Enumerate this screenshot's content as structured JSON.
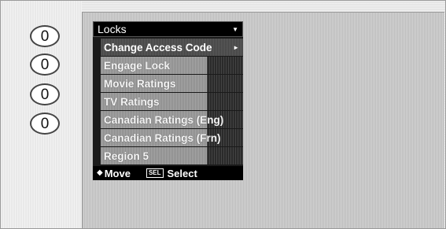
{
  "callouts": [
    "0",
    "0",
    "0",
    "0"
  ],
  "menu": {
    "title": "Locks",
    "items": [
      {
        "label": "Change Access Code",
        "selected": true
      },
      {
        "label": "Engage Lock"
      },
      {
        "label": "Movie Ratings"
      },
      {
        "label": "TV Ratings"
      },
      {
        "label": "Canadian Ratings (Eng)"
      },
      {
        "label": "Canadian Ratings (Frn)"
      },
      {
        "label": "Region 5"
      }
    ]
  },
  "footer": {
    "move_label": "Move",
    "sel_badge": "SEL",
    "select_label": "Select"
  },
  "icons": {
    "dropdown": "triangle-down-icon",
    "submenu": "triangle-right-icon",
    "move": "four-way-arrow-icon"
  }
}
